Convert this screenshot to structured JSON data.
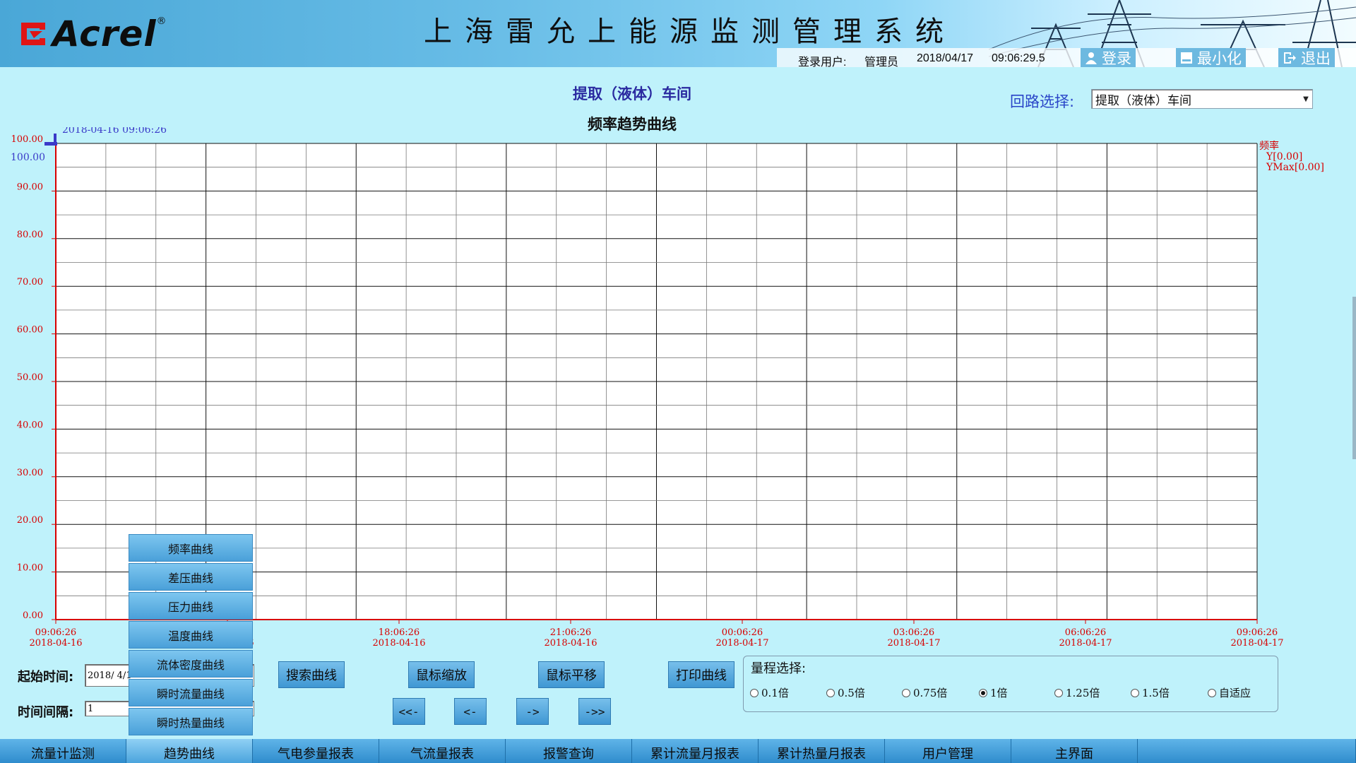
{
  "header": {
    "logo_text": "Acrel",
    "logo_reg": "®",
    "system_title": "上海雷允上能源监测管理系统",
    "login_user_label": "登录用户:",
    "login_user": "管理员",
    "date": "2018/04/17",
    "time": "09:06:29.5",
    "login_btn": "登录",
    "minimize_btn": "最小化",
    "exit_btn": "退出"
  },
  "page": {
    "location_title": "提取（液体）车间",
    "chart_title": "频率趋势曲线",
    "circuit_label": "回路选择:",
    "circuit_value": "提取（液体）车间"
  },
  "chart_data": {
    "type": "line",
    "title": "频率趋势曲线",
    "series": [
      {
        "name": "频率",
        "values": []
      }
    ],
    "ylim": [
      0,
      100
    ],
    "yticks": [
      "0.00",
      "10.00",
      "20.00",
      "30.00",
      "40.00",
      "50.00",
      "60.00",
      "70.00",
      "80.00",
      "90.00",
      "100.00"
    ],
    "xticks": [
      {
        "time": "09:06:26",
        "date": "2018-04-16"
      },
      {
        "time": "15:06:26",
        "date": "2018-04-16"
      },
      {
        "time": "18:06:26",
        "date": "2018-04-16"
      },
      {
        "time": "21:06:26",
        "date": "2018-04-16"
      },
      {
        "time": "00:06:26",
        "date": "2018-04-17"
      },
      {
        "time": "03:06:26",
        "date": "2018-04-17"
      },
      {
        "time": "06:06:26",
        "date": "2018-04-17"
      },
      {
        "time": "09:06:26",
        "date": "2018-04-17"
      }
    ],
    "cursor_time": "2018-04-16 09:06:26",
    "cursor_value": "100.00",
    "legend": {
      "name": "频率",
      "y": "Y[0.00]",
      "ymax": "YMax[0.00]"
    },
    "colors": {
      "axis": "#d80000",
      "grid": "#222222",
      "cursor": "#3a3ac8"
    }
  },
  "controls": {
    "start_time_label": "起始时间:",
    "start_time_value": "2018/ 4/1",
    "interval_label": "时间间隔:",
    "interval_value": "1",
    "search_btn": "搜索曲线",
    "zoom_btn": "鼠标缩放",
    "pan_btn": "鼠标平移",
    "print_btn": "打印曲线",
    "nav": [
      "<<-",
      "<-",
      "->",
      "->>"
    ],
    "range_title": "量程选择:",
    "range_options": [
      "0.1倍",
      "0.5倍",
      "0.75倍",
      "1倍",
      "1.25倍",
      "1.5倍",
      "自适应"
    ],
    "range_selected": "1倍"
  },
  "dropdown_menu": [
    "频率曲线",
    "差压曲线",
    "压力曲线",
    "温度曲线",
    "流体密度曲线",
    "瞬时流量曲线",
    "瞬时热量曲线"
  ],
  "bottom_nav": [
    "流量计监测",
    "趋势曲线",
    "气电参量报表",
    "气流量报表",
    "报警查询",
    "累计流量月报表",
    "累计热量月报表",
    "用户管理",
    "主界面"
  ],
  "bottom_nav_active": "趋势曲线"
}
